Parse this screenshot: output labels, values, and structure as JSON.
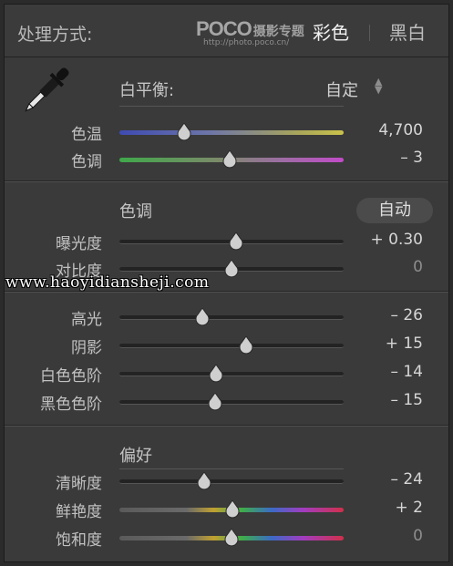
{
  "header": {
    "title": "处理方式:",
    "watermark": {
      "brand": "POCO",
      "cn": "摄影专题",
      "url": "http://photo.poco.cn/"
    },
    "mode_color": "彩色",
    "mode_bw": "黑白"
  },
  "white_balance": {
    "label": "白平衡:",
    "value": "自定",
    "icon": "eyedropper-icon"
  },
  "basic_sliders": [
    {
      "name": "temperature",
      "label": "色温",
      "value": "4,700",
      "position": 0.29
    },
    {
      "name": "tint",
      "label": "色调",
      "value": "– 3",
      "position": 0.49
    }
  ],
  "tone": {
    "heading": "色调",
    "auto_label": "自动",
    "sliders_top": [
      {
        "name": "exposure",
        "label": "曝光度",
        "value": "+ 0.30",
        "position": 0.52
      },
      {
        "name": "contrast",
        "label": "对比度",
        "value": "0",
        "position": 0.5,
        "dim": true
      }
    ],
    "sliders_bottom": [
      {
        "name": "highlights",
        "label": "高光",
        "value": "– 26",
        "position": 0.37
      },
      {
        "name": "shadows",
        "label": "阴影",
        "value": "+ 15",
        "position": 0.565
      },
      {
        "name": "whites",
        "label": "白色色阶",
        "value": "– 14",
        "position": 0.43
      },
      {
        "name": "blacks",
        "label": "黑色色阶",
        "value": "– 15",
        "position": 0.425
      }
    ]
  },
  "presence": {
    "heading": "偏好",
    "sliders": [
      {
        "name": "clarity",
        "label": "清晰度",
        "value": "– 24",
        "position": 0.38
      },
      {
        "name": "vibrance",
        "label": "鲜艳度",
        "value": "+ 2",
        "position": 0.505
      },
      {
        "name": "saturation",
        "label": "饱和度",
        "value": "0",
        "position": 0.5,
        "dim": true
      }
    ]
  },
  "site_watermark": "www.haoyidiansheji.com"
}
